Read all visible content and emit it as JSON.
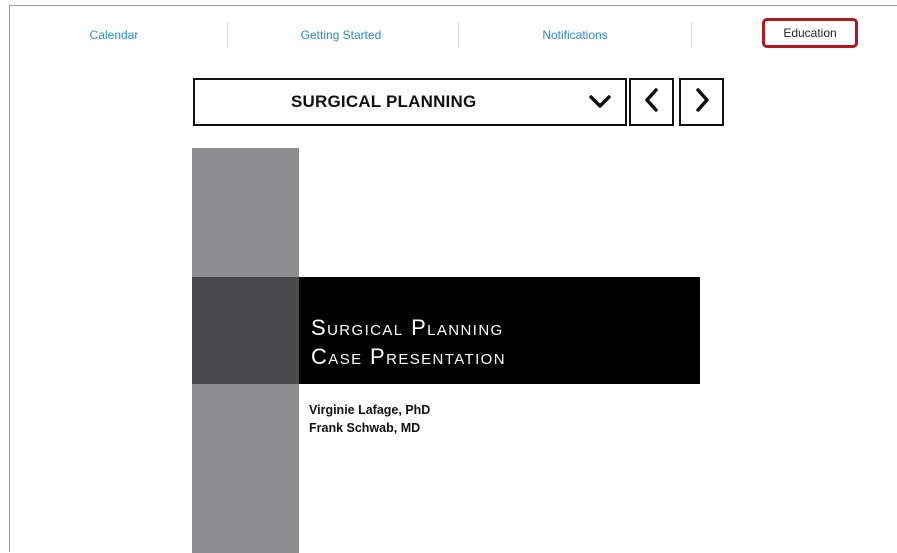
{
  "nav": {
    "items": [
      {
        "label": "Calendar"
      },
      {
        "label": "Getting Started"
      },
      {
        "label": "Notifications"
      },
      {
        "label": "Education"
      }
    ],
    "active_highlight_color": "#b0181e",
    "link_color": "#2a8ccf"
  },
  "selector": {
    "label": "SURGICAL PLANNING",
    "dropdown_icon": "chevron-down-icon",
    "prev_icon": "chevron-left-icon",
    "next_icon": "chevron-right-icon"
  },
  "slide": {
    "title_line1": "Surgical Planning",
    "title_line2": "Case Presentation",
    "authors": [
      "Virginie Lafage, PhD",
      "Frank Schwab, MD"
    ],
    "colors": {
      "side_bar": "#8e8e90",
      "side_block": "#4a4a4d",
      "title_band": "#000000"
    }
  }
}
